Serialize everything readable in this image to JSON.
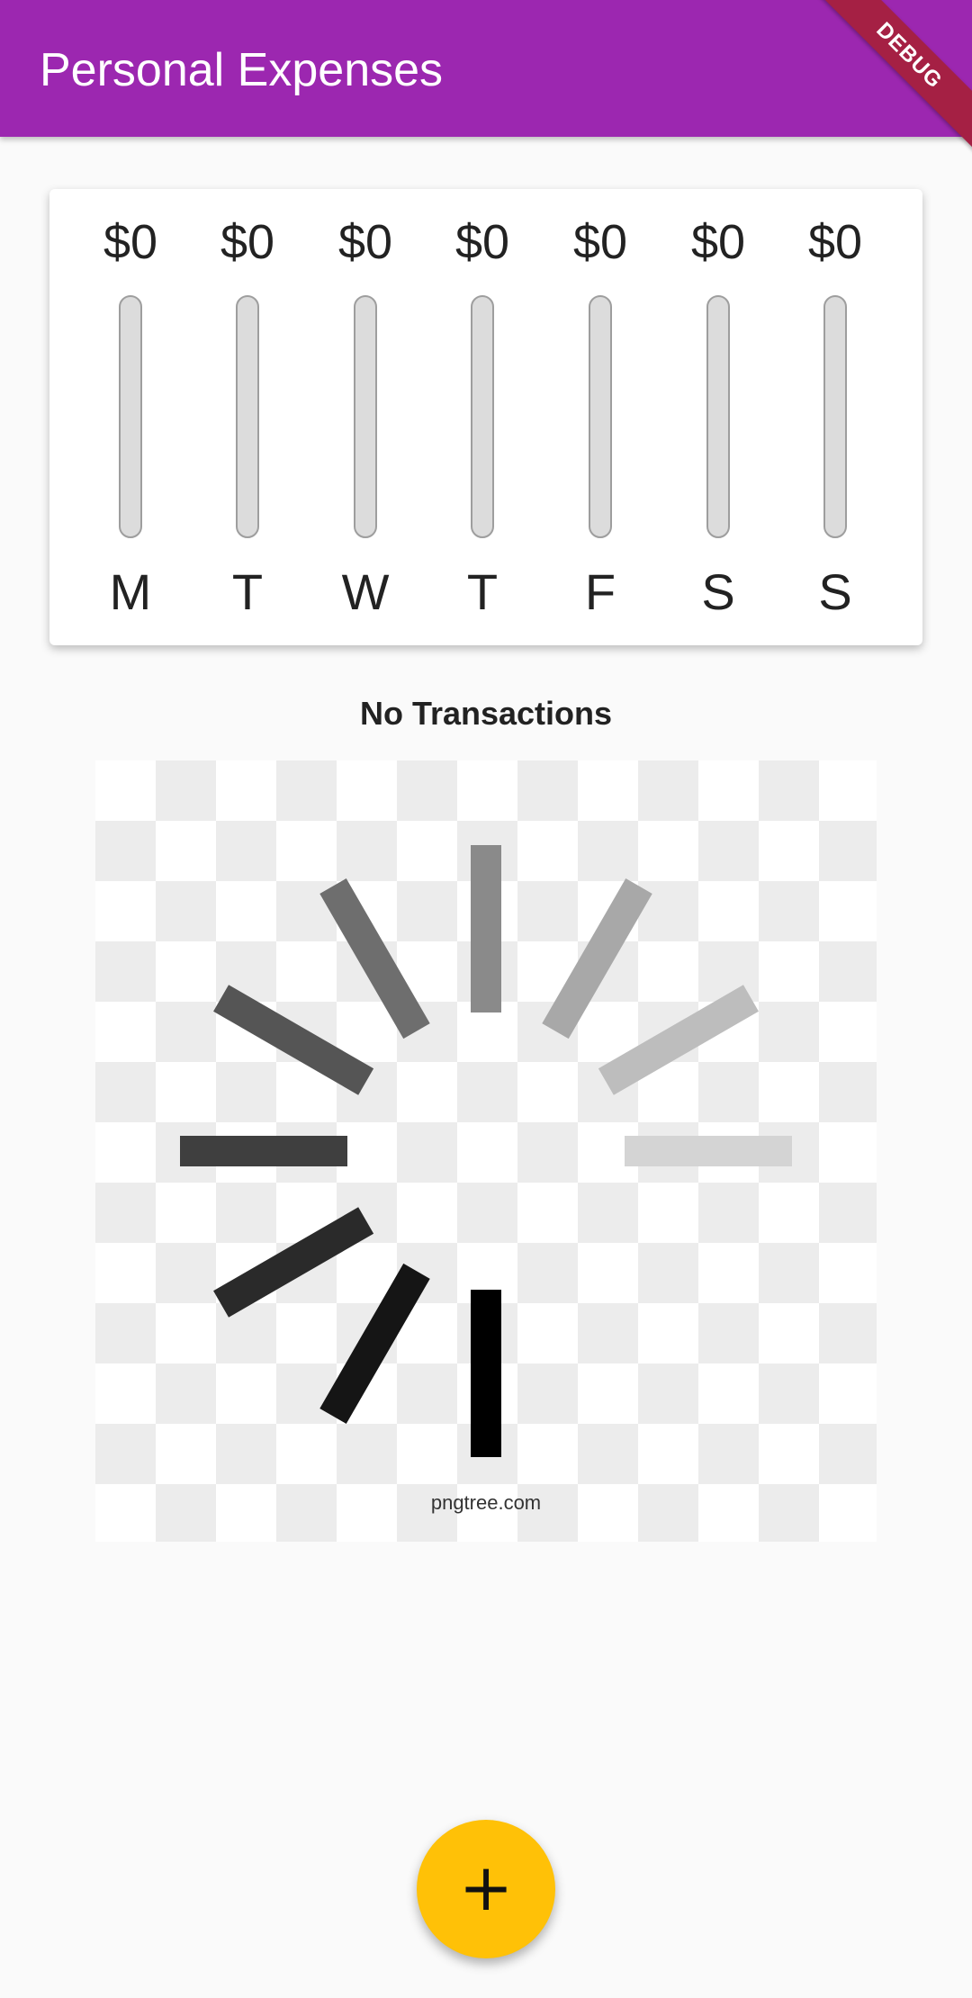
{
  "appbar": {
    "title": "Personal Expenses",
    "add_icon": "plus-icon",
    "background": "#9c27b0"
  },
  "debug_banner": {
    "label": "DEBUG",
    "color": "#a52044"
  },
  "chart": {
    "days": [
      {
        "day": "M",
        "amount": "$0",
        "fraction": 0
      },
      {
        "day": "T",
        "amount": "$0",
        "fraction": 0
      },
      {
        "day": "W",
        "amount": "$0",
        "fraction": 0
      },
      {
        "day": "T",
        "amount": "$0",
        "fraction": 0
      },
      {
        "day": "F",
        "amount": "$0",
        "fraction": 0
      },
      {
        "day": "S",
        "amount": "$0",
        "fraction": 0
      },
      {
        "day": "S",
        "amount": "$0",
        "fraction": 0
      }
    ]
  },
  "empty_state": {
    "title": "No Transactions",
    "image_icon": "loading-spinner-icon",
    "watermark": "pngtree.com"
  },
  "fab": {
    "icon": "plus-icon",
    "label": "+",
    "color": "#ffc107"
  }
}
